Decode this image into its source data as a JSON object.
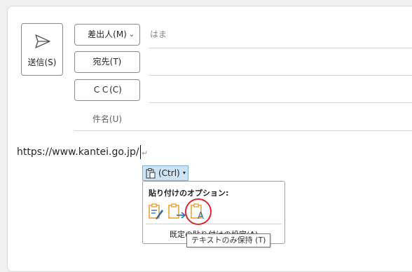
{
  "compose": {
    "send_label": "送信(S)",
    "from_label": "差出人(M)",
    "from_value": "はま",
    "to_label": "宛先(T)",
    "cc_label": "ＣＣ(C)",
    "subject_label": "件名(U)"
  },
  "body": {
    "url_text": "https://www.kantei.go.jp/",
    "paragraph_mark": "↵"
  },
  "paste_options": {
    "ctrl_label": "(Ctrl)",
    "popup_title": "貼り付けのオプション:",
    "options": [
      {
        "icon": "keep-source-formatting-icon"
      },
      {
        "icon": "merge-formatting-icon"
      },
      {
        "icon": "keep-text-only-icon"
      }
    ],
    "default_paste_label": "既定の貼り付けの設定(A)...",
    "tooltip": "テキストのみ保持 (T)"
  },
  "colors": {
    "highlight_circle": "#d9252b",
    "ctrl_button_bg": "#cde4f7",
    "clipboard_orange": "#e8a33a",
    "accent_blue": "#2b6cb0"
  }
}
